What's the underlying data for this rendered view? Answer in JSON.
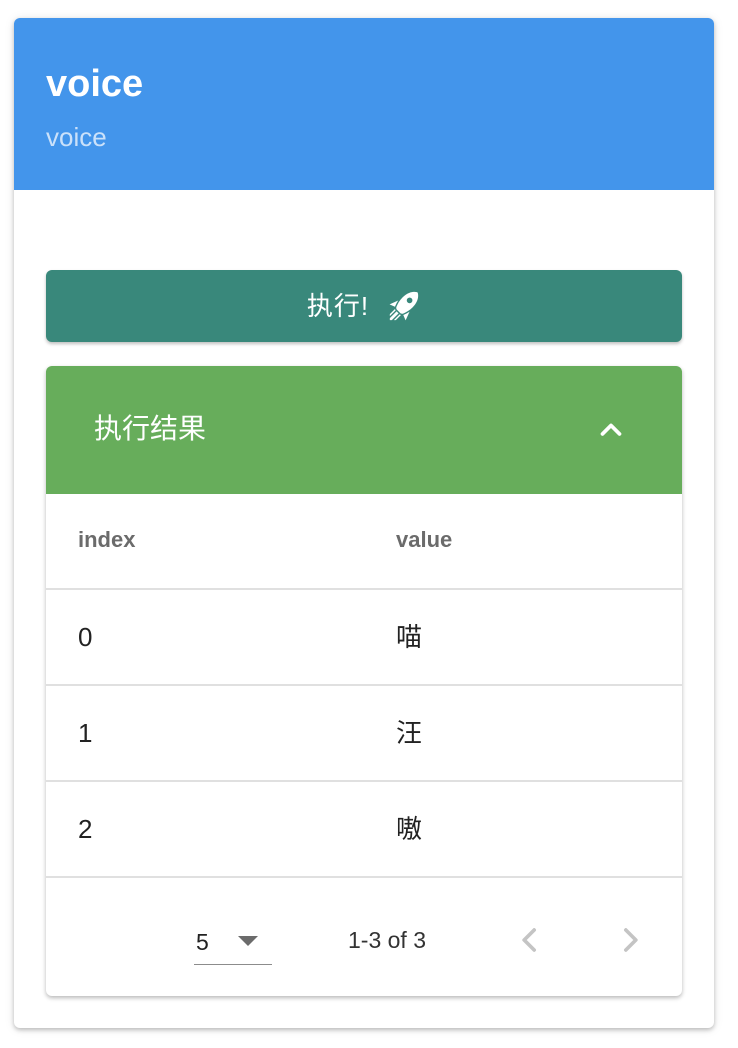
{
  "card": {
    "title": "voice",
    "subtitle": "voice"
  },
  "run_button": {
    "label": "执行!",
    "icon": "rocket-icon"
  },
  "results_panel": {
    "title": "执行结果",
    "toggle_icon": "chevron-up-icon",
    "expanded": true
  },
  "table": {
    "headers": [
      "index",
      "value"
    ],
    "rows": [
      [
        "0",
        "喵"
      ],
      [
        "1",
        "汪"
      ],
      [
        "2",
        "嗷"
      ]
    ]
  },
  "pagination": {
    "rows_per_page": "5",
    "range": "1-3 of 3",
    "prev_icon": "chevron-left-icon",
    "next_icon": "chevron-right-icon"
  },
  "colors": {
    "header_blue": "#4395eb",
    "button_teal": "#39887b",
    "panel_green": "#67ad5b"
  }
}
